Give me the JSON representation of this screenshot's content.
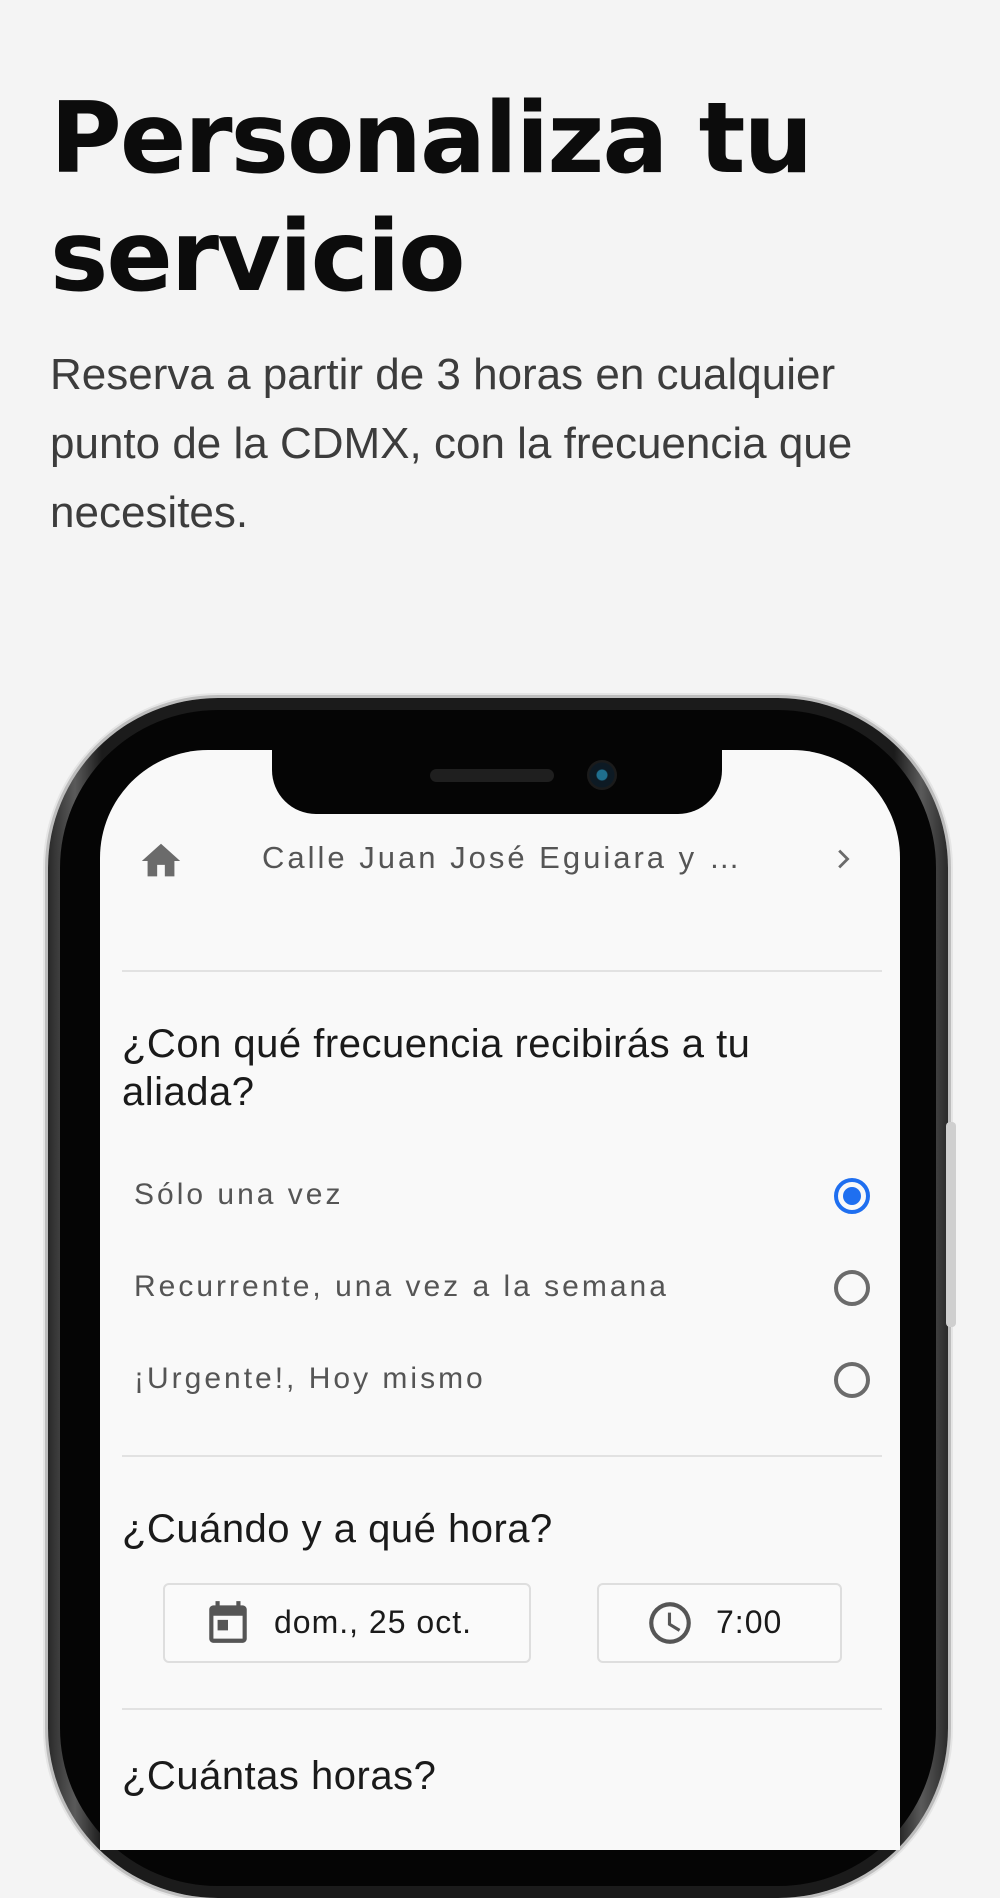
{
  "hero": {
    "title": "Personaliza tu servicio",
    "subtitle": "Reserva a partir de 3 horas en cualquier punto de la CDMX, con la frecuencia que necesites."
  },
  "app": {
    "topbar": {
      "home_icon": "home-icon",
      "address": "Calle Juan José Eguiara y …",
      "chevron_icon": "chevron-right-icon"
    },
    "frequency": {
      "question": "¿Con qué frecuencia recibirás a tu aliada?",
      "options": [
        {
          "label": "Sólo una vez",
          "selected": true
        },
        {
          "label": "Recurrente, una vez a la semana",
          "selected": false
        },
        {
          "label": "¡Urgente!, Hoy mismo",
          "selected": false
        }
      ]
    },
    "schedule": {
      "question": "¿Cuándo y a qué hora?",
      "date_icon": "calendar-icon",
      "date": "dom., 25 oct.",
      "time_icon": "clock-icon",
      "time": "7:00"
    },
    "hours": {
      "question": "¿Cuántas horas?"
    },
    "accent_color": "#1f6ff0"
  }
}
